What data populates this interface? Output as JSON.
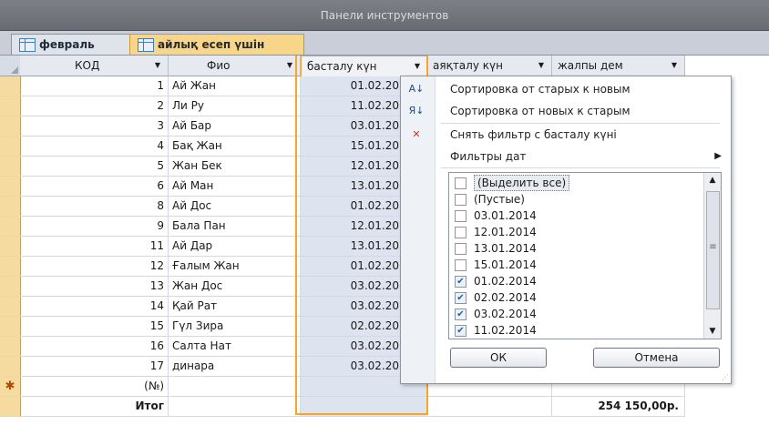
{
  "toolbar": {
    "title": "Панели инструментов"
  },
  "tabs": [
    {
      "label": "февраль",
      "icon": "table-icon",
      "active": false
    },
    {
      "label": "айлық есеп үшін",
      "icon": "table-icon",
      "active": true
    }
  ],
  "columns": {
    "kod": "КОД",
    "fio": "Фио",
    "bas": "басталу күн",
    "aya": "аяқталу күн",
    "zhal": "жалпы дем"
  },
  "rows": [
    {
      "kod": "1",
      "fio": "Ай Жан",
      "bas": "01.02.20"
    },
    {
      "kod": "2",
      "fio": "Ли Ру",
      "bas": "11.02.20"
    },
    {
      "kod": "3",
      "fio": "Ай Бар",
      "bas": "03.01.20"
    },
    {
      "kod": "4",
      "fio": "Бақ Жан",
      "bas": "15.01.20"
    },
    {
      "kod": "5",
      "fio": "Жан Бек",
      "bas": "12.01.20"
    },
    {
      "kod": "6",
      "fio": "Ай Ман",
      "bas": "13.01.20"
    },
    {
      "kod": "8",
      "fio": "Ай Дос",
      "bas": "01.02.20"
    },
    {
      "kod": "9",
      "fio": "Бала Пан",
      "bas": "12.01.20"
    },
    {
      "kod": "11",
      "fio": "Ай Дар",
      "bas": "13.01.20"
    },
    {
      "kod": "12",
      "fio": "Ғалым Жан",
      "bas": "01.02.20"
    },
    {
      "kod": "13",
      "fio": "Жан Дос",
      "bas": "03.02.20"
    },
    {
      "kod": "14",
      "fio": "Қай Рат",
      "bas": "03.02.20"
    },
    {
      "kod": "15",
      "fio": "Гүл Зира",
      "bas": "02.02.20"
    },
    {
      "kod": "16",
      "fio": "Салта Нат",
      "bas": "03.02.20"
    },
    {
      "kod": "17",
      "fio": "динара",
      "bas": "03.02.20"
    }
  ],
  "new_row": {
    "marker": "✱",
    "kod": "(№)"
  },
  "total_row": {
    "label": "Итог",
    "sum": "254 150,00р."
  },
  "menu": {
    "sort_asc": "Сортировка от старых к новым",
    "sort_desc": "Сортировка от новых к старым",
    "clear_filter": "Снять фильтр с басталу күні",
    "date_filters": "Фильтры дат"
  },
  "filter_list": [
    {
      "label": "(Выделить все)",
      "checked": false
    },
    {
      "label": "(Пустые)",
      "checked": false
    },
    {
      "label": "03.01.2014",
      "checked": false
    },
    {
      "label": "12.01.2014",
      "checked": false
    },
    {
      "label": "13.01.2014",
      "checked": false
    },
    {
      "label": "15.01.2014",
      "checked": false
    },
    {
      "label": "01.02.2014",
      "checked": true
    },
    {
      "label": "02.02.2014",
      "checked": true
    },
    {
      "label": "03.02.2014",
      "checked": true
    },
    {
      "label": "11.02.2014",
      "checked": true
    }
  ],
  "buttons": {
    "ok": "ОК",
    "cancel": "Отмена"
  },
  "colors": {
    "accent": "#f5a623",
    "tab_active": "#f7d68a",
    "selected_column": "#dde3ef"
  }
}
